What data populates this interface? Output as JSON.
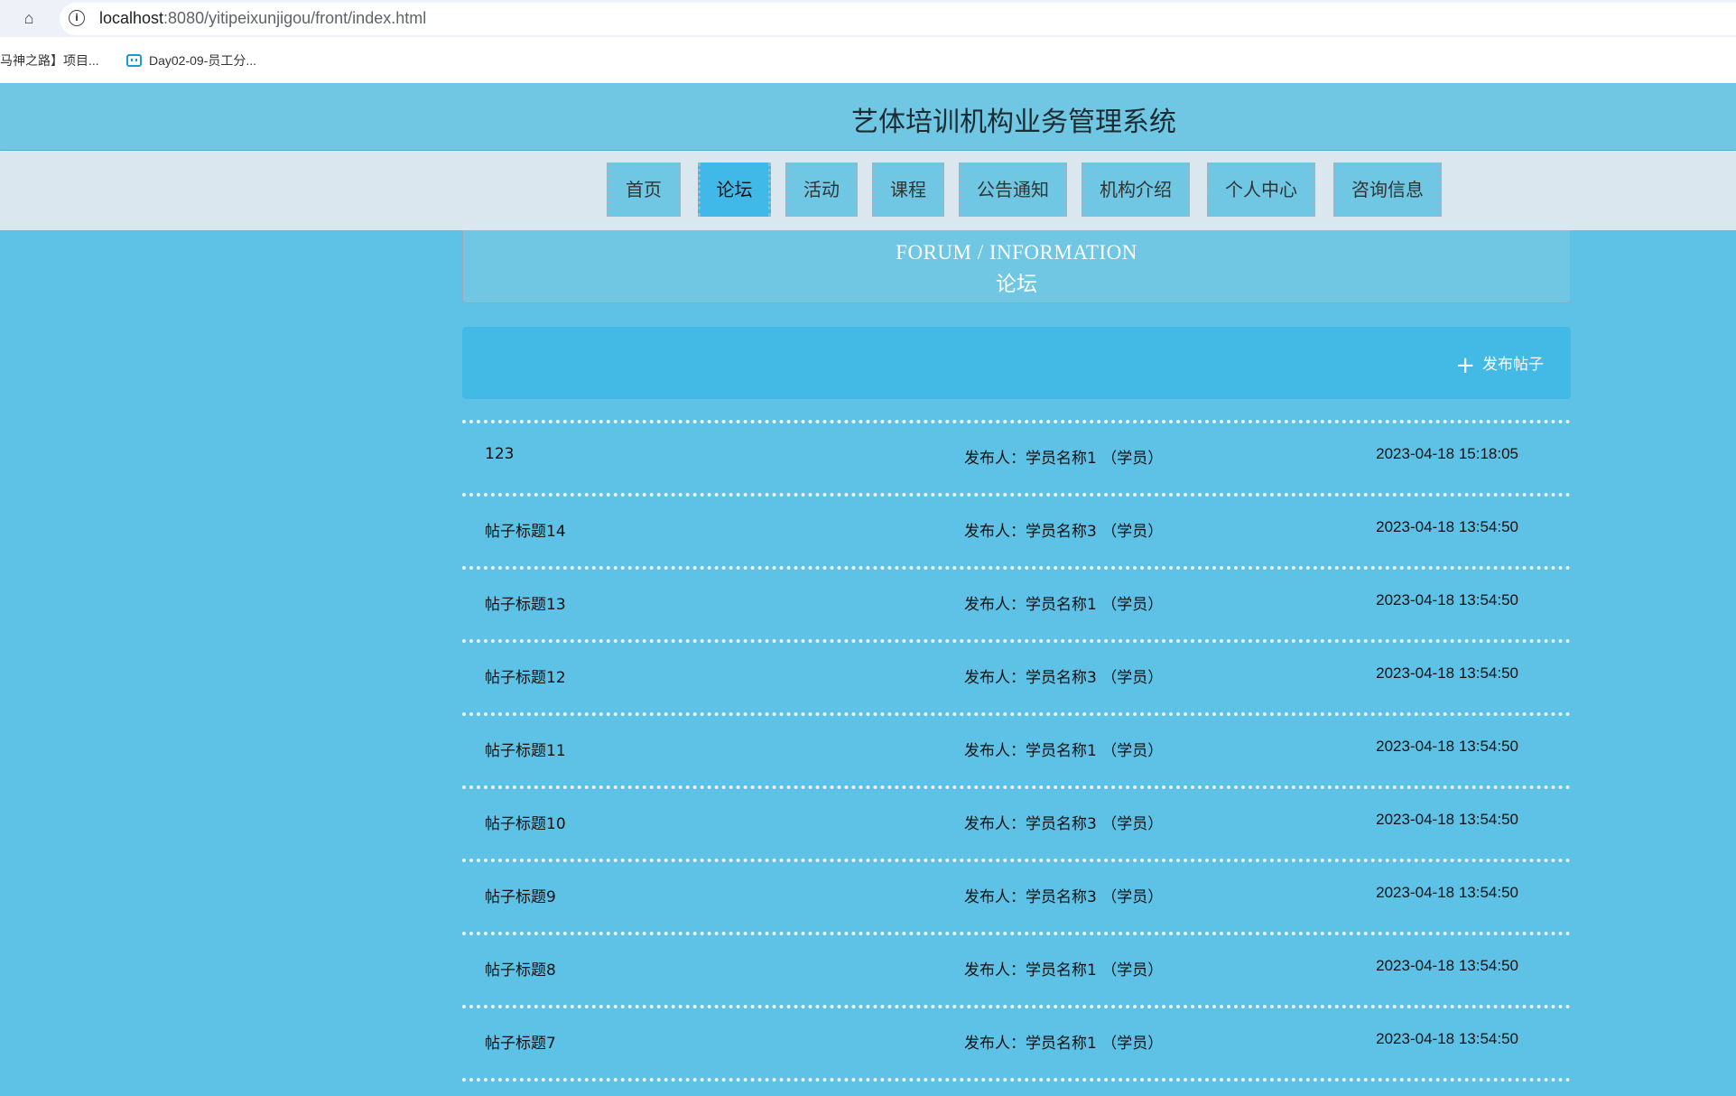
{
  "browser": {
    "url_host": "localhost",
    "url_path": ":8080/yitipeixunjigou/front/index.html",
    "bookmarks": [
      "马神之路】项目...",
      "Day02-09-员工分..."
    ]
  },
  "header": {
    "title": "艺体培训机构业务管理系统"
  },
  "nav": [
    {
      "label": "首页",
      "active": false
    },
    {
      "label": "论坛",
      "active": true
    },
    {
      "label": "活动",
      "active": false
    },
    {
      "label": "课程",
      "active": false
    },
    {
      "label": "公告通知",
      "active": false
    },
    {
      "label": "机构介绍",
      "active": false
    },
    {
      "label": "个人中心",
      "active": false
    },
    {
      "label": "咨询信息",
      "active": false
    }
  ],
  "section": {
    "title_en": "FORUM / INFORMATION",
    "title_zh": "论坛"
  },
  "actions": {
    "publish_label": "发布帖子"
  },
  "posts": [
    {
      "title": "123",
      "author": "发布人：学员名称1 （学员）",
      "time": "2023-04-18 15:18:05"
    },
    {
      "title": "帖子标题14",
      "author": "发布人：学员名称3 （学员）",
      "time": "2023-04-18 13:54:50"
    },
    {
      "title": "帖子标题13",
      "author": "发布人：学员名称1 （学员）",
      "time": "2023-04-18 13:54:50"
    },
    {
      "title": "帖子标题12",
      "author": "发布人：学员名称3 （学员）",
      "time": "2023-04-18 13:54:50"
    },
    {
      "title": "帖子标题11",
      "author": "发布人：学员名称1 （学员）",
      "time": "2023-04-18 13:54:50"
    },
    {
      "title": "帖子标题10",
      "author": "发布人：学员名称3 （学员）",
      "time": "2023-04-18 13:54:50"
    },
    {
      "title": "帖子标题9",
      "author": "发布人：学员名称3 （学员）",
      "time": "2023-04-18 13:54:50"
    },
    {
      "title": "帖子标题8",
      "author": "发布人：学员名称1 （学员）",
      "time": "2023-04-18 13:54:50"
    },
    {
      "title": "帖子标题7",
      "author": "发布人：学员名称1 （学员）",
      "time": "2023-04-18 13:54:50"
    }
  ],
  "colors": {
    "page_bg": "#5ec1e6",
    "header_bg": "#6fc7e3",
    "nav_bg": "#dbe7ef",
    "accent": "#41b9e8"
  }
}
